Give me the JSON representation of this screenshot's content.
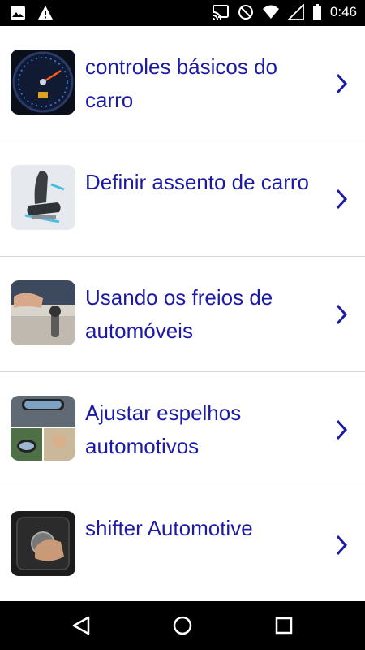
{
  "status_bar": {
    "time": "0:46",
    "left_icons": [
      "image-icon",
      "warning-icon"
    ],
    "right_icons": [
      "cast-icon",
      "do-not-disturb-icon",
      "wifi-icon",
      "signal-icon",
      "battery-icon"
    ]
  },
  "list": {
    "items": [
      {
        "title": "controles básicos do carro",
        "thumbnail": "dashboard-gauge-image"
      },
      {
        "title": "Definir assento de carro",
        "thumbnail": "car-seat-image"
      },
      {
        "title": "Usando os freios de automóveis",
        "thumbnail": "handbrake-image"
      },
      {
        "title": "Ajustar espelhos automotivos",
        "thumbnail": "car-mirrors-image"
      },
      {
        "title": "shifter Automotive",
        "thumbnail": "gear-shifter-image"
      }
    ]
  },
  "nav_bar": {
    "buttons": [
      "back-icon",
      "home-icon",
      "recents-icon"
    ]
  },
  "colors": {
    "title_text": "#1d1aa6",
    "chevron": "#1d1aa6",
    "divider": "#d8d8d8",
    "status_bar_bg": "#000000",
    "nav_bar_bg": "#000000"
  }
}
